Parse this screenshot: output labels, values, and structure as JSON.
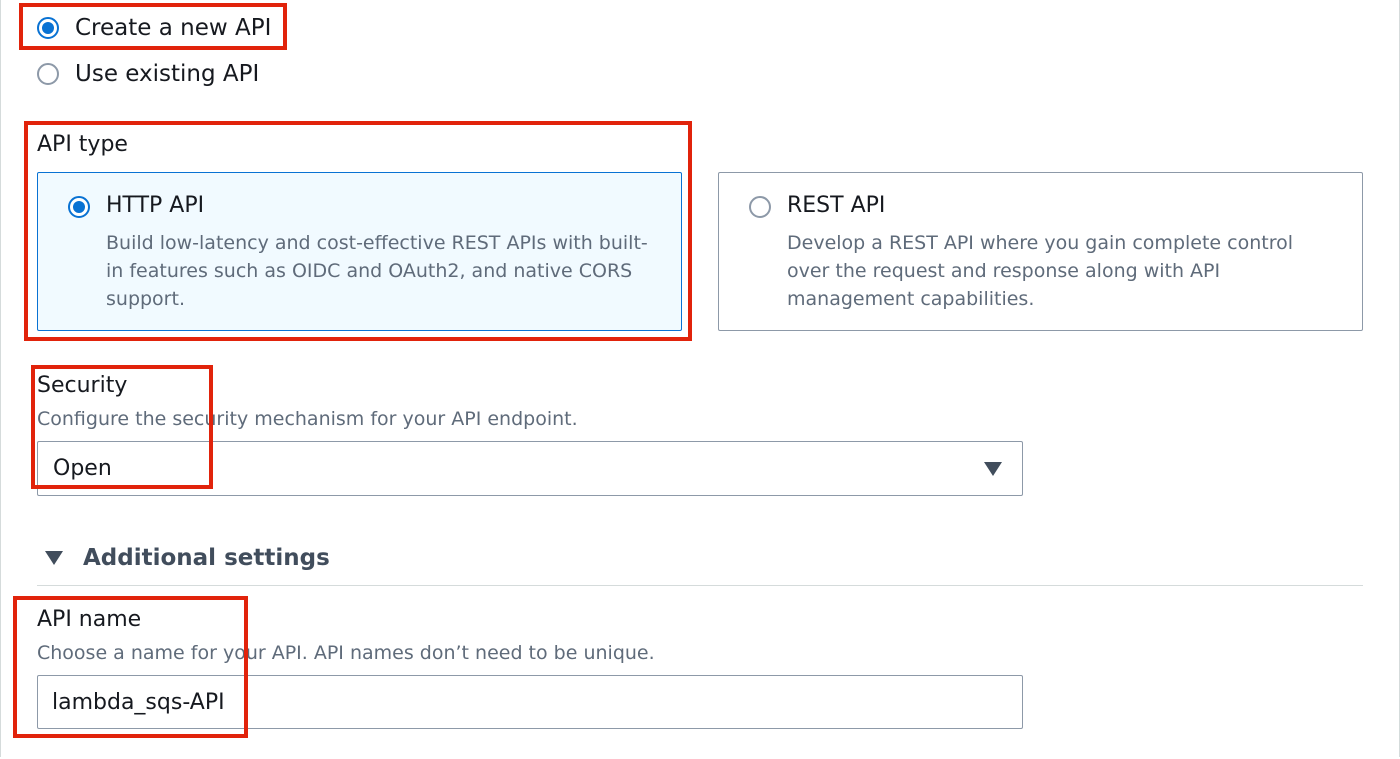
{
  "api_choice": {
    "options": [
      {
        "label": "Create a new API",
        "checked": true
      },
      {
        "label": "Use existing API",
        "checked": false
      }
    ]
  },
  "api_type": {
    "label": "API type",
    "cards": [
      {
        "title": "HTTP API",
        "description_lines": [
          "Build low-latency and cost-effective REST APIs with built-",
          "in features such as OIDC and OAuth2, and native CORS",
          "support."
        ],
        "selected": true
      },
      {
        "title": "REST API",
        "description_lines": [
          "Develop a REST API where you gain complete control",
          "over the request and response along with API",
          "management capabilities."
        ],
        "selected": false
      }
    ]
  },
  "security": {
    "label": "Security",
    "description": "Configure the security mechanism for your API endpoint.",
    "selected_value": "Open"
  },
  "additional_settings": {
    "label": "Additional settings",
    "expanded": true
  },
  "api_name": {
    "label": "API name",
    "description": "Choose a name for your API. API names don’t need to be unique.",
    "value": "lambda_sqs-API"
  },
  "colors": {
    "accent": "#0972d3",
    "highlight": "#e1230b",
    "selected_card_bg": "#f1faff"
  }
}
